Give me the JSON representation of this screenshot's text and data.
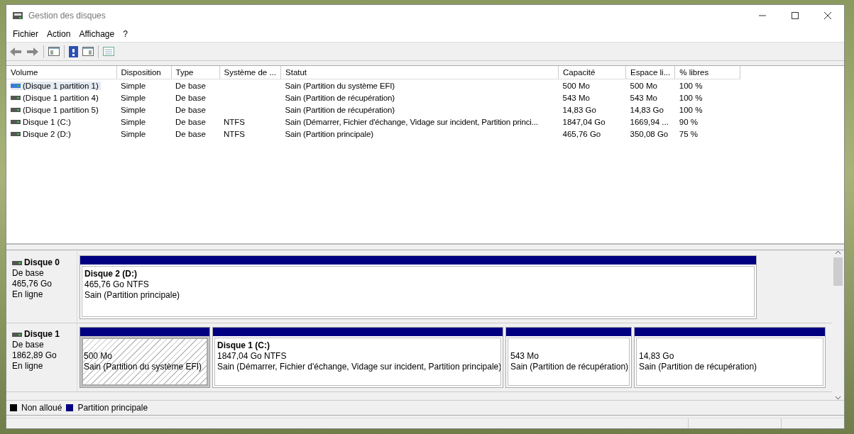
{
  "window": {
    "title": "Gestion des disques"
  },
  "menu": [
    "Fichier",
    "Action",
    "Affichage",
    "?"
  ],
  "volume_list": {
    "columns": [
      "Volume",
      "Disposition",
      "Type",
      "Système de ...",
      "Statut",
      "Capacité",
      "Espace li...",
      "% libres"
    ],
    "rows": [
      {
        "selected": true,
        "cells": [
          "(Disque 1 partition 1)",
          "Simple",
          "De base",
          "",
          "Sain (Partition du système EFI)",
          "500 Mo",
          "500 Mo",
          "100 %"
        ]
      },
      {
        "selected": false,
        "cells": [
          "(Disque 1 partition 4)",
          "Simple",
          "De base",
          "",
          "Sain (Partition de récupération)",
          "543 Mo",
          "543 Mo",
          "100 %"
        ]
      },
      {
        "selected": false,
        "cells": [
          "(Disque 1 partition 5)",
          "Simple",
          "De base",
          "",
          "Sain (Partition de récupération)",
          "14,83 Go",
          "14,83 Go",
          "100 %"
        ]
      },
      {
        "selected": false,
        "cells": [
          "Disque 1 (C:)",
          "Simple",
          "De base",
          "NTFS",
          "Sain (Démarrer, Fichier d'échange, Vidage sur incident, Partition princi...",
          "1847,04 Go",
          "1669,94 ...",
          "90 %"
        ]
      },
      {
        "selected": false,
        "cells": [
          "Disque 2 (D:)",
          "Simple",
          "De base",
          "NTFS",
          "Sain (Partition principale)",
          "465,76 Go",
          "350,08 Go",
          "75 %"
        ]
      }
    ]
  },
  "disks": [
    {
      "name": "Disque 0",
      "type": "De base",
      "size": "465,76 Go",
      "status": "En ligne",
      "partitions": [
        {
          "title": "Disque 2  (D:)",
          "size": "465,76 Go NTFS",
          "status": "Sain (Partition principale)",
          "selected": false
        }
      ]
    },
    {
      "name": "Disque 1",
      "type": "De base",
      "size": "1862,89 Go",
      "status": "En ligne",
      "partitions": [
        {
          "size": "500 Mo",
          "status": "Sain (Partition du système EFI)",
          "selected": true
        },
        {
          "title": "Disque 1  (C:)",
          "size": "1847,04 Go NTFS",
          "status": "Sain (Démarrer, Fichier d'échange, Vidage sur incident, Partition principale)",
          "selected": false
        },
        {
          "size": "543 Mo",
          "status": "Sain (Partition de récupération)",
          "selected": false
        },
        {
          "size": "14,83 Go",
          "status": "Sain (Partition de récupération)",
          "selected": false
        }
      ]
    }
  ],
  "legend": [
    {
      "label": "Non alloué",
      "color": "#000000"
    },
    {
      "label": "Partition principale",
      "color": "#000080"
    }
  ]
}
